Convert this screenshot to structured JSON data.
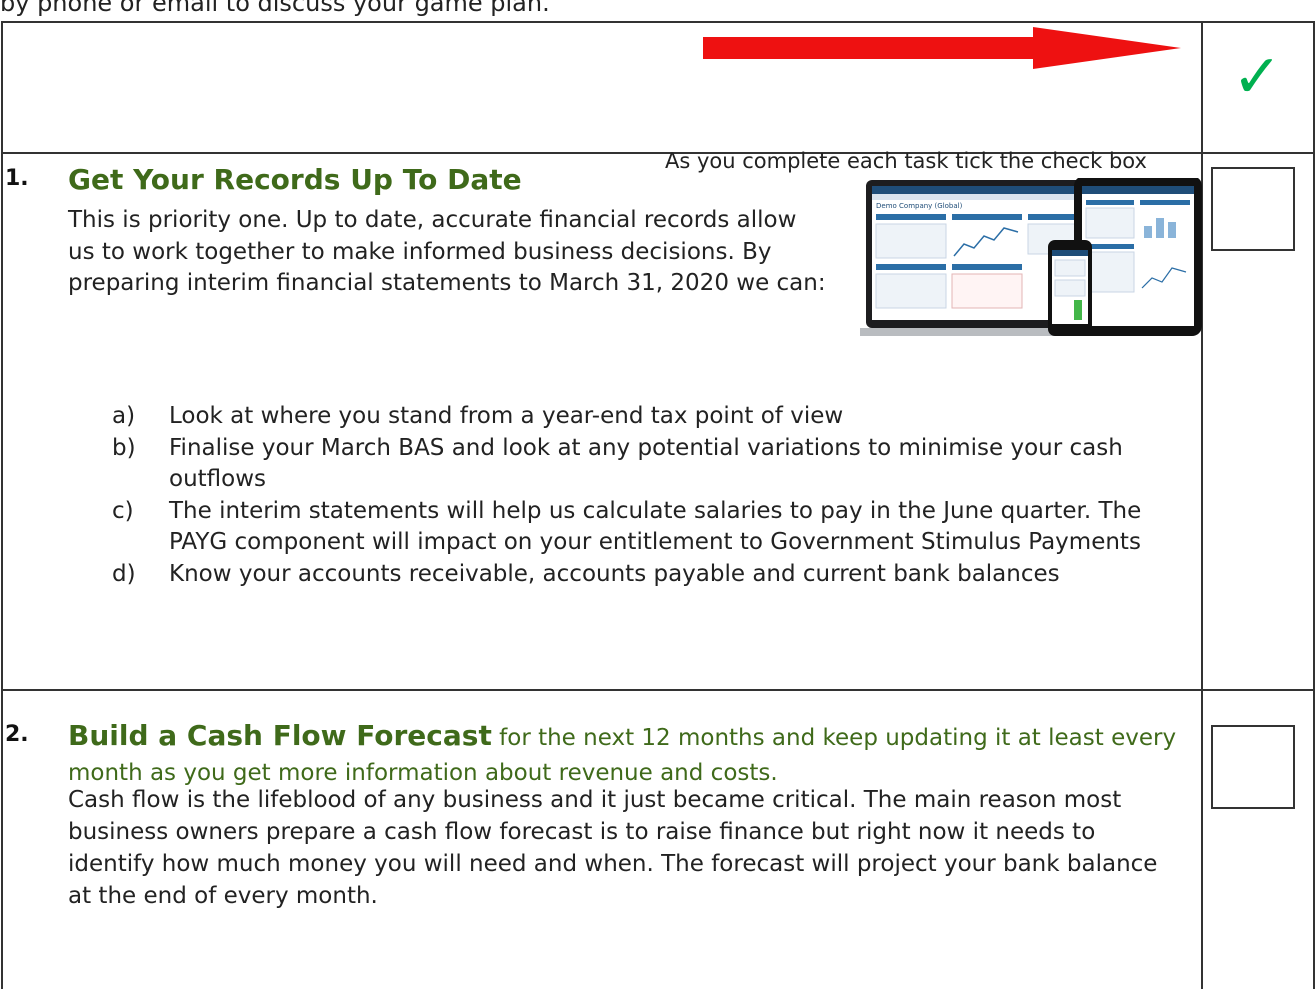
{
  "intro_line": "by phone or email to discuss your game plan.",
  "header": {
    "instruction": "As you complete each task tick the check box",
    "check_glyph": "✓",
    "arrow_color": "#ee1111",
    "check_color": "#00b050"
  },
  "sections": [
    {
      "number": "1.",
      "title": "Get Your Records Up To Date",
      "intro": "This is priority one. Up to date, accurate financial records allow us to work together to make informed business decisions. By preparing interim financial statements to March 31, 2020 we can:",
      "items": [
        {
          "letter": "a)",
          "text": "Look at where you stand from a year-end tax point of view"
        },
        {
          "letter": "b)",
          "text": "Finalise your March BAS and look at any potential variations to minimise your cash outflows"
        },
        {
          "letter": "c)",
          "text": "The interim statements will help us calculate salaries to pay in the June quarter. The PAYG component will impact on your entitlement to Government Stimulus Payments"
        },
        {
          "letter": "d)",
          "text": "Know your accounts receivable, accounts payable and current bank balances"
        }
      ],
      "image_title": "Demo Company (Global)"
    },
    {
      "number": "2.",
      "title": "Build a Cash Flow Forecast",
      "title_rest": " for the next 12 months and keep updating it at least every month as you get more information about revenue and costs.",
      "body": "Cash flow is the lifeblood of any business and it just became critical. The main reason most business owners prepare a cash flow forecast is to raise finance but right now it needs to identify how much money you will need and when. The forecast will project your bank balance at the end of every month."
    }
  ],
  "heading_color": "#3f6a1a"
}
